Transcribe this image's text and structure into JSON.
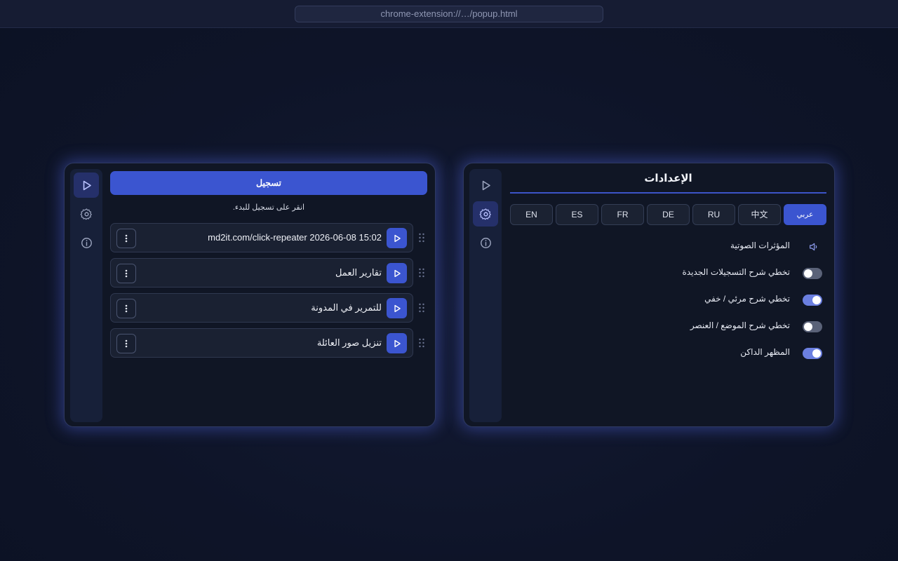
{
  "browser": {
    "url": "chrome-extension://…/popup.html"
  },
  "left_panel": {
    "record_label": "تسجيل",
    "hint": "انقر على تسجيل للبدء.",
    "recordings": [
      {
        "name": "md2it.com/click-repeater 2026-06-08 15:02"
      },
      {
        "name": "تقارير العمل"
      },
      {
        "name": "للتمرير في المدونة"
      },
      {
        "name": "تنزيل صور العائلة"
      }
    ]
  },
  "right_panel": {
    "title": "الإعدادات",
    "languages": [
      {
        "label": "عربي",
        "active": true
      },
      {
        "label": "中文",
        "active": false
      },
      {
        "label": "RU",
        "active": false
      },
      {
        "label": "DE",
        "active": false
      },
      {
        "label": "FR",
        "active": false
      },
      {
        "label": "ES",
        "active": false
      },
      {
        "label": "EN",
        "active": false
      }
    ],
    "settings": {
      "sound_effects": "المؤثرات الصوتية",
      "skip_new_recordings_tutorial": "تخطي شرح التسجيلات الجديدة",
      "skip_visible_hidden_tutorial": "تخطي شرح مرئي / خفي",
      "skip_position_element_tutorial": "تخطي شرح الموضع / العنصر",
      "dark_mode": "المظهر الداكن"
    },
    "toggle_states": {
      "skip_new_recordings_tutorial": false,
      "skip_visible_hidden_tutorial": true,
      "skip_position_element_tutorial": false,
      "dark_mode": true
    }
  },
  "icons": {
    "sidebar": [
      "play-icon",
      "gear-icon",
      "info-icon"
    ],
    "row": [
      "drag-handle-icon",
      "play-icon",
      "more-vertical-icon"
    ],
    "setting": [
      "speaker-icon"
    ]
  },
  "colors": {
    "accent": "#3b55d0",
    "toggle_on": "#6b7fe0",
    "toggle_off": "#5a6278",
    "panel_bg": "#101625",
    "sidebar_bg": "#172039"
  }
}
